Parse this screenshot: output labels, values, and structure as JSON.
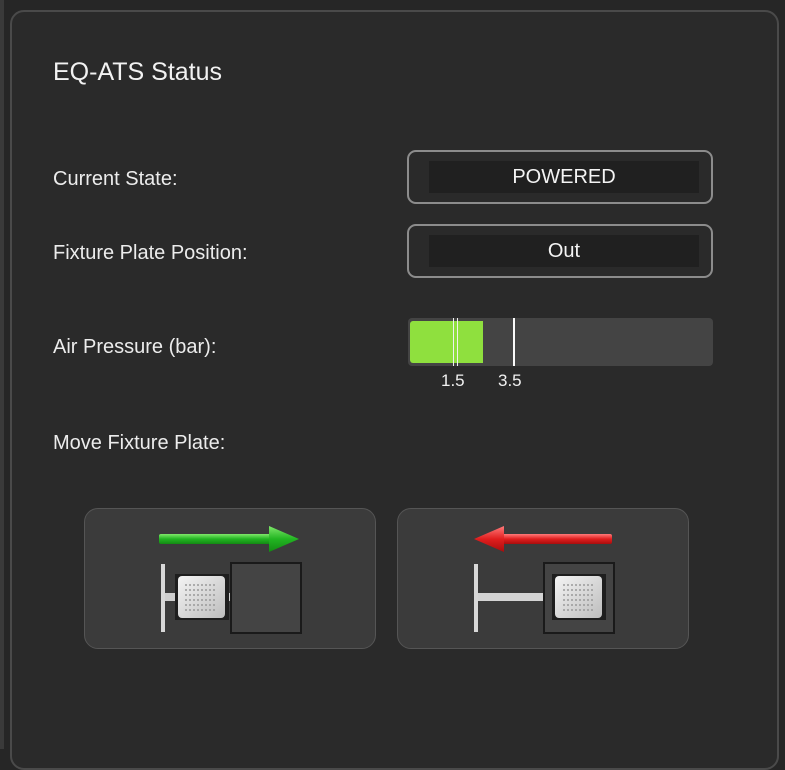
{
  "panel": {
    "title": "EQ-ATS Status"
  },
  "status": {
    "current_state_label": "Current State:",
    "current_state_value": "POWERED",
    "fixture_position_label": "Fixture Plate Position:",
    "fixture_position_value": "Out",
    "air_pressure_label": "Air Pressure (bar):"
  },
  "air_pressure_gauge": {
    "fill_fraction": 0.24,
    "fill_color": "#8fe03e",
    "threshold_markers": [
      {
        "label": "1.5"
      },
      {
        "label": "3.5"
      }
    ]
  },
  "move": {
    "label": "Move Fixture Plate:",
    "buttons": [
      {
        "name": "move-in-button",
        "icon": "arrow-right-icon",
        "arrow_color": "#2fbf2f"
      },
      {
        "name": "move-out-button",
        "icon": "arrow-left-icon",
        "arrow_color": "#e02020"
      }
    ]
  }
}
